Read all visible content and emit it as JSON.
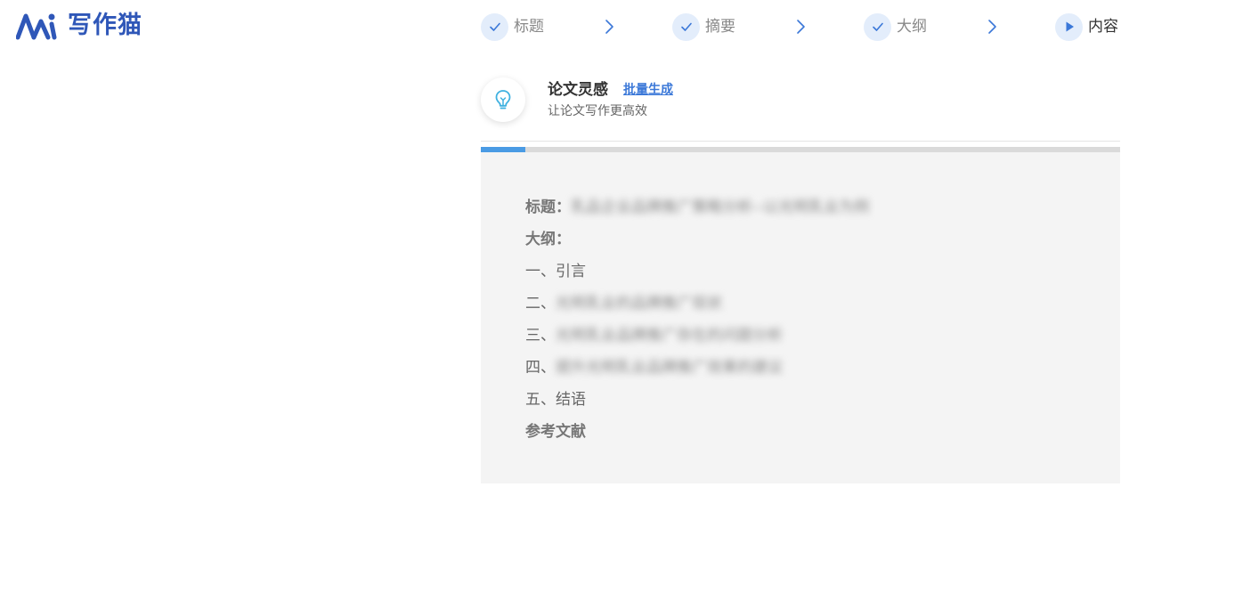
{
  "app": {
    "logo_text": "写作猫",
    "brand_color": "#2f57b8"
  },
  "stepper": {
    "steps": [
      {
        "label": "标题",
        "state": "done",
        "icon": "check-icon"
      },
      {
        "label": "摘要",
        "state": "done",
        "icon": "check-icon"
      },
      {
        "label": "大纲",
        "state": "done",
        "icon": "check-icon"
      },
      {
        "label": "内容",
        "state": "current",
        "icon": "play-icon"
      }
    ],
    "separator_icon": "chevron-right-icon",
    "accent_color": "#3b78d8"
  },
  "header": {
    "icon": "lightbulb-icon",
    "title": "论文灵感",
    "link": "批量生成",
    "subtitle": "让论文写作更高效"
  },
  "progress": {
    "percent": 7,
    "color": "#4a9be4"
  },
  "content": {
    "title_label": "标题：",
    "title_value": "乳品企业品牌推广策略分析--以光明乳业为例",
    "outline_label": "大纲：",
    "outline_items": [
      {
        "prefix": "一、",
        "text": "引言"
      },
      {
        "prefix": "二、",
        "text": "光明乳业的品牌推广现状"
      },
      {
        "prefix": "三、",
        "text": "光明乳业品牌推广存在的问题分析"
      },
      {
        "prefix": "四、",
        "text": "提升光明乳业品牌推广效果的建议"
      },
      {
        "prefix": "五、",
        "text": "结语"
      }
    ],
    "references_label": "参考文献"
  }
}
